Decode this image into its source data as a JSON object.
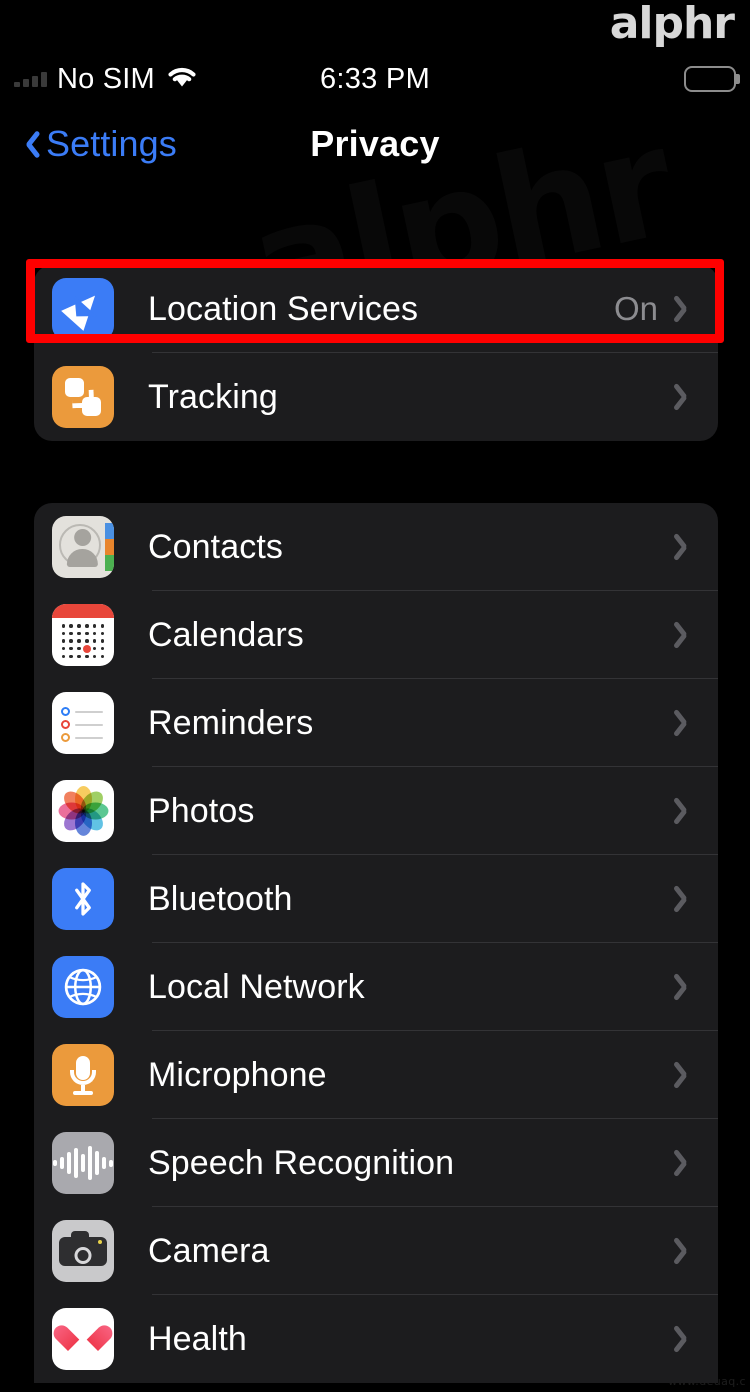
{
  "brand": {
    "logo": "alphr",
    "watermark": "alphr",
    "source_url": "www.deuaq.c"
  },
  "status_bar": {
    "carrier": "No SIM",
    "time": "6:33 PM",
    "wifi_icon": "wifi-icon",
    "signal_icon": "signal-bars-icon",
    "battery_icon": "battery-full-icon"
  },
  "nav_bar": {
    "back_label": "Settings",
    "back_icon": "chevron-left-icon",
    "title": "Privacy"
  },
  "highlight": {
    "color": "#fe0000",
    "target": "Location Services"
  },
  "colors": {
    "accent_blue": "#3b7cf6",
    "group_bg": "#1c1c1e",
    "separator": "#333336",
    "value_gray": "#8c8c90",
    "chevron_gray": "#5b5b60",
    "screen_bg": "#000000"
  },
  "groups": [
    {
      "id": "group-top",
      "rows": [
        {
          "label": "Location Services",
          "value": "On",
          "icon": "location-services-icon",
          "chevron": "chevron-right-icon",
          "highlighted": true
        },
        {
          "label": "Tracking",
          "value": "",
          "icon": "tracking-icon",
          "chevron": "chevron-right-icon",
          "highlighted": false
        }
      ]
    },
    {
      "id": "group-main",
      "rows": [
        {
          "label": "Contacts",
          "value": "",
          "icon": "contacts-icon",
          "chevron": "chevron-right-icon"
        },
        {
          "label": "Calendars",
          "value": "",
          "icon": "calendars-icon",
          "chevron": "chevron-right-icon"
        },
        {
          "label": "Reminders",
          "value": "",
          "icon": "reminders-icon",
          "chevron": "chevron-right-icon"
        },
        {
          "label": "Photos",
          "value": "",
          "icon": "photos-icon",
          "chevron": "chevron-right-icon"
        },
        {
          "label": "Bluetooth",
          "value": "",
          "icon": "bluetooth-icon",
          "chevron": "chevron-right-icon"
        },
        {
          "label": "Local Network",
          "value": "",
          "icon": "local-network-icon",
          "chevron": "chevron-right-icon"
        },
        {
          "label": "Microphone",
          "value": "",
          "icon": "microphone-icon",
          "chevron": "chevron-right-icon"
        },
        {
          "label": "Speech Recognition",
          "value": "",
          "icon": "speech-recognition-icon",
          "chevron": "chevron-right-icon"
        },
        {
          "label": "Camera",
          "value": "",
          "icon": "camera-icon",
          "chevron": "chevron-right-icon"
        },
        {
          "label": "Health",
          "value": "",
          "icon": "health-icon",
          "chevron": "chevron-right-icon"
        }
      ]
    }
  ]
}
